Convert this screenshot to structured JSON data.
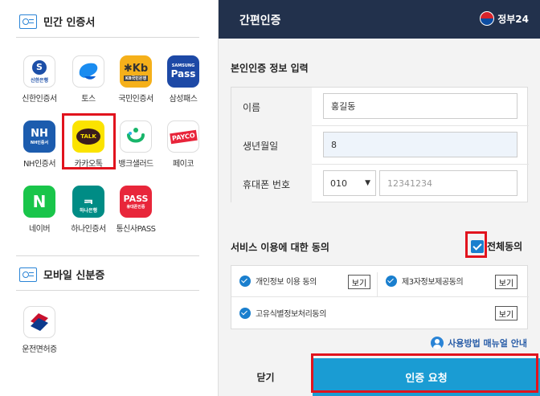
{
  "left": {
    "private_title": "민간 인증서",
    "mobile_title": "모바일 신분증",
    "apps": [
      {
        "label": "신한인증서",
        "logo_text": "S",
        "logo_sub": "신한은행",
        "color": "#ffffff"
      },
      {
        "label": "토스",
        "logo_text": "",
        "color": "#ffffff"
      },
      {
        "label": "국민인증서",
        "logo_text": "Kb",
        "logo_sub": "KB국민은행",
        "color": "#f5b01a"
      },
      {
        "label": "삼성패스",
        "logo_text": "Pass",
        "logo_sub": "SAMSUNG",
        "color": "#1d49a6"
      },
      {
        "label": "NH인증서",
        "logo_text": "NH",
        "logo_sub": "NH인증서",
        "color": "#1c5cae"
      },
      {
        "label": "카카오톡",
        "logo_text": "TALK",
        "color": "#fbe300"
      },
      {
        "label": "뱅크샐러드",
        "logo_text": "",
        "color": "#ffffff"
      },
      {
        "label": "페이코",
        "logo_text": "PAYCO",
        "color": "#ffffff"
      },
      {
        "label": "네이버",
        "logo_text": "N",
        "color": "#19c54a"
      },
      {
        "label": "하나인증서",
        "logo_text": "",
        "logo_sub": "하나은행",
        "color": "#008c85"
      },
      {
        "label": "통신사PASS",
        "logo_text": "PASS",
        "logo_sub": "휴대폰인증",
        "color": "#e8263a"
      }
    ],
    "mobile_apps": [
      {
        "label": "운전면허증"
      }
    ]
  },
  "header": {
    "title": "간편인증",
    "brand": "정부24"
  },
  "form": {
    "title": "본인인증 정보 입력",
    "name_label": "이름",
    "name_value": "홍길동",
    "birth_label": "생년월일",
    "birth_value": "8",
    "phone_label": "휴대폰 번호",
    "carrier_value": "010",
    "phone_placeholder": "12341234"
  },
  "agree": {
    "title": "서비스 이용에 대한 동의",
    "all_label": "전체동의",
    "items": [
      {
        "label": "개인정보 이용 동의",
        "btn": "보기"
      },
      {
        "label": "제3자정보제공동의",
        "btn": "보기"
      },
      {
        "label": "고유식별정보처리동의",
        "btn": "보기"
      }
    ]
  },
  "manual": "사용방법 매뉴얼 안내",
  "buttons": {
    "close": "닫기",
    "submit": "인증 요청"
  }
}
